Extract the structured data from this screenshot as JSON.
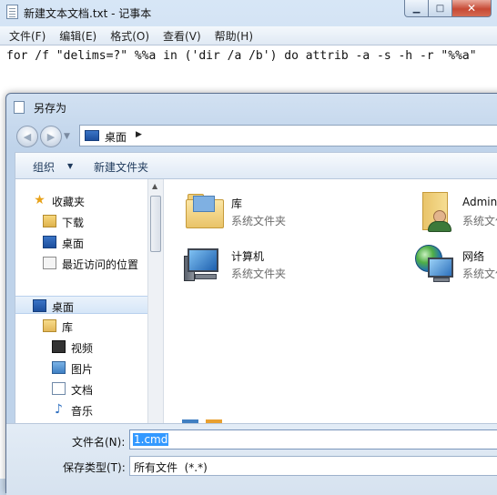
{
  "notepad": {
    "title": "新建文本文档.txt - 记事本",
    "menu": [
      "文件(F)",
      "编辑(E)",
      "格式(O)",
      "查看(V)",
      "帮助(H)"
    ],
    "content": "for /f \"delims=?\" %%a in ('dir /a /b') do attrib -a -s -h -r \"%%a\""
  },
  "dialog": {
    "title": "另存为",
    "address": {
      "location": "桌面"
    },
    "toolbar": {
      "organize": "组织",
      "new_folder": "新建文件夹"
    },
    "nav_items": [
      {
        "label": "收藏夹",
        "icon": "star-icon"
      },
      {
        "label": "下载",
        "icon": "downloads-folder-icon"
      },
      {
        "label": "桌面",
        "icon": "desktop-icon"
      },
      {
        "label": "最近访问的位置",
        "icon": "recent-places-icon"
      },
      {
        "label": "桌面",
        "icon": "desktop-icon",
        "selected": true
      },
      {
        "label": "库",
        "icon": "library-icon"
      },
      {
        "label": "视频",
        "icon": "video-icon"
      },
      {
        "label": "图片",
        "icon": "pictures-icon"
      },
      {
        "label": "文档",
        "icon": "documents-icon"
      },
      {
        "label": "音乐",
        "icon": "music-icon"
      }
    ],
    "items": [
      {
        "name": "库",
        "type": "系统文件夹",
        "icon": "libraries-icon"
      },
      {
        "name": "Administrator",
        "type": "系统文件夹",
        "icon": "user-folder-icon"
      },
      {
        "name": "计算机",
        "type": "系统文件夹",
        "icon": "computer-icon"
      },
      {
        "name": "网络",
        "type": "系统文件夹",
        "icon": "network-icon"
      }
    ],
    "filename_label": "文件名(N):",
    "filename_value": "1.cmd",
    "filetype_label": "保存类型(T):",
    "filetype_value": "所有文件  (*.*)"
  }
}
